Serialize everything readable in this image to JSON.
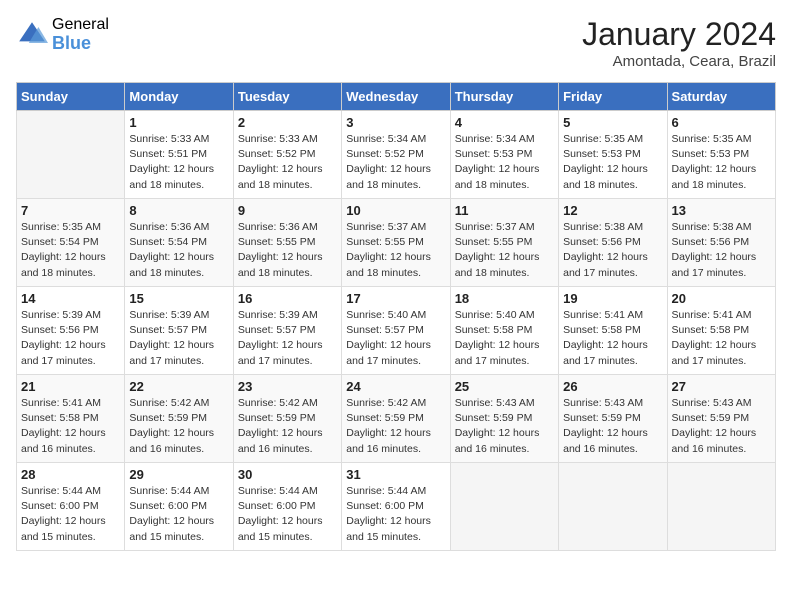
{
  "header": {
    "logo_general": "General",
    "logo_blue": "Blue",
    "month_year": "January 2024",
    "location": "Amontada, Ceara, Brazil"
  },
  "days_of_week": [
    "Sunday",
    "Monday",
    "Tuesday",
    "Wednesday",
    "Thursday",
    "Friday",
    "Saturday"
  ],
  "weeks": [
    [
      {
        "day": "",
        "info": ""
      },
      {
        "day": "1",
        "info": "Sunrise: 5:33 AM\nSunset: 5:51 PM\nDaylight: 12 hours\nand 18 minutes."
      },
      {
        "day": "2",
        "info": "Sunrise: 5:33 AM\nSunset: 5:52 PM\nDaylight: 12 hours\nand 18 minutes."
      },
      {
        "day": "3",
        "info": "Sunrise: 5:34 AM\nSunset: 5:52 PM\nDaylight: 12 hours\nand 18 minutes."
      },
      {
        "day": "4",
        "info": "Sunrise: 5:34 AM\nSunset: 5:53 PM\nDaylight: 12 hours\nand 18 minutes."
      },
      {
        "day": "5",
        "info": "Sunrise: 5:35 AM\nSunset: 5:53 PM\nDaylight: 12 hours\nand 18 minutes."
      },
      {
        "day": "6",
        "info": "Sunrise: 5:35 AM\nSunset: 5:53 PM\nDaylight: 12 hours\nand 18 minutes."
      }
    ],
    [
      {
        "day": "7",
        "info": "Sunrise: 5:35 AM\nSunset: 5:54 PM\nDaylight: 12 hours\nand 18 minutes."
      },
      {
        "day": "8",
        "info": "Sunrise: 5:36 AM\nSunset: 5:54 PM\nDaylight: 12 hours\nand 18 minutes."
      },
      {
        "day": "9",
        "info": "Sunrise: 5:36 AM\nSunset: 5:55 PM\nDaylight: 12 hours\nand 18 minutes."
      },
      {
        "day": "10",
        "info": "Sunrise: 5:37 AM\nSunset: 5:55 PM\nDaylight: 12 hours\nand 18 minutes."
      },
      {
        "day": "11",
        "info": "Sunrise: 5:37 AM\nSunset: 5:55 PM\nDaylight: 12 hours\nand 18 minutes."
      },
      {
        "day": "12",
        "info": "Sunrise: 5:38 AM\nSunset: 5:56 PM\nDaylight: 12 hours\nand 17 minutes."
      },
      {
        "day": "13",
        "info": "Sunrise: 5:38 AM\nSunset: 5:56 PM\nDaylight: 12 hours\nand 17 minutes."
      }
    ],
    [
      {
        "day": "14",
        "info": "Sunrise: 5:39 AM\nSunset: 5:56 PM\nDaylight: 12 hours\nand 17 minutes."
      },
      {
        "day": "15",
        "info": "Sunrise: 5:39 AM\nSunset: 5:57 PM\nDaylight: 12 hours\nand 17 minutes."
      },
      {
        "day": "16",
        "info": "Sunrise: 5:39 AM\nSunset: 5:57 PM\nDaylight: 12 hours\nand 17 minutes."
      },
      {
        "day": "17",
        "info": "Sunrise: 5:40 AM\nSunset: 5:57 PM\nDaylight: 12 hours\nand 17 minutes."
      },
      {
        "day": "18",
        "info": "Sunrise: 5:40 AM\nSunset: 5:58 PM\nDaylight: 12 hours\nand 17 minutes."
      },
      {
        "day": "19",
        "info": "Sunrise: 5:41 AM\nSunset: 5:58 PM\nDaylight: 12 hours\nand 17 minutes."
      },
      {
        "day": "20",
        "info": "Sunrise: 5:41 AM\nSunset: 5:58 PM\nDaylight: 12 hours\nand 17 minutes."
      }
    ],
    [
      {
        "day": "21",
        "info": "Sunrise: 5:41 AM\nSunset: 5:58 PM\nDaylight: 12 hours\nand 16 minutes."
      },
      {
        "day": "22",
        "info": "Sunrise: 5:42 AM\nSunset: 5:59 PM\nDaylight: 12 hours\nand 16 minutes."
      },
      {
        "day": "23",
        "info": "Sunrise: 5:42 AM\nSunset: 5:59 PM\nDaylight: 12 hours\nand 16 minutes."
      },
      {
        "day": "24",
        "info": "Sunrise: 5:42 AM\nSunset: 5:59 PM\nDaylight: 12 hours\nand 16 minutes."
      },
      {
        "day": "25",
        "info": "Sunrise: 5:43 AM\nSunset: 5:59 PM\nDaylight: 12 hours\nand 16 minutes."
      },
      {
        "day": "26",
        "info": "Sunrise: 5:43 AM\nSunset: 5:59 PM\nDaylight: 12 hours\nand 16 minutes."
      },
      {
        "day": "27",
        "info": "Sunrise: 5:43 AM\nSunset: 5:59 PM\nDaylight: 12 hours\nand 16 minutes."
      }
    ],
    [
      {
        "day": "28",
        "info": "Sunrise: 5:44 AM\nSunset: 6:00 PM\nDaylight: 12 hours\nand 15 minutes."
      },
      {
        "day": "29",
        "info": "Sunrise: 5:44 AM\nSunset: 6:00 PM\nDaylight: 12 hours\nand 15 minutes."
      },
      {
        "day": "30",
        "info": "Sunrise: 5:44 AM\nSunset: 6:00 PM\nDaylight: 12 hours\nand 15 minutes."
      },
      {
        "day": "31",
        "info": "Sunrise: 5:44 AM\nSunset: 6:00 PM\nDaylight: 12 hours\nand 15 minutes."
      },
      {
        "day": "",
        "info": ""
      },
      {
        "day": "",
        "info": ""
      },
      {
        "day": "",
        "info": ""
      }
    ]
  ]
}
